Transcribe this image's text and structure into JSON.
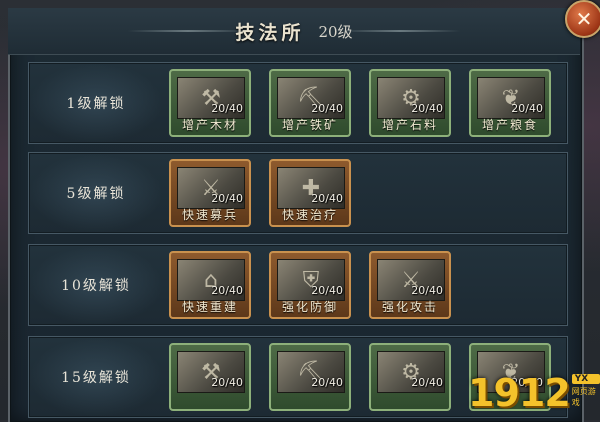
{
  "header": {
    "title": "技法所",
    "level": "20级",
    "close_label": "✕"
  },
  "rows": [
    {
      "label": "1级解锁",
      "tiles": [
        {
          "name": "增产木材",
          "count": "20/40",
          "style": "green",
          "icon": "lumber-icon"
        },
        {
          "name": "增产铁矿",
          "count": "20/40",
          "style": "green",
          "icon": "iron-icon"
        },
        {
          "name": "增产石料",
          "count": "20/40",
          "style": "green",
          "icon": "stone-icon"
        },
        {
          "name": "增产粮食",
          "count": "20/40",
          "style": "green",
          "icon": "grain-icon"
        }
      ]
    },
    {
      "label": "5级解锁",
      "tiles": [
        {
          "name": "快速募兵",
          "count": "20/40",
          "style": "orange",
          "icon": "recruit-icon"
        },
        {
          "name": "快速治疗",
          "count": "20/40",
          "style": "orange",
          "icon": "heal-icon"
        }
      ]
    },
    {
      "label": "10级解锁",
      "tiles": [
        {
          "name": "快速重建",
          "count": "20/40",
          "style": "orange",
          "icon": "rebuild-icon"
        },
        {
          "name": "强化防御",
          "count": "20/40",
          "style": "orange",
          "icon": "defense-icon"
        },
        {
          "name": "强化攻击",
          "count": "20/40",
          "style": "orange",
          "icon": "attack-icon"
        }
      ]
    },
    {
      "label": "15级解锁",
      "tiles": [
        {
          "name": "",
          "count": "20/40",
          "style": "green",
          "icon": "lumber-icon"
        },
        {
          "name": "",
          "count": "20/40",
          "style": "green",
          "icon": "iron-icon"
        },
        {
          "name": "",
          "count": "20/40",
          "style": "green",
          "icon": "stone-icon"
        },
        {
          "name": "",
          "count": "20/40",
          "style": "green",
          "icon": "grain-icon"
        }
      ]
    }
  ],
  "watermark": {
    "digits": "1912",
    "badge": "YX",
    "sub": "网页游戏"
  }
}
